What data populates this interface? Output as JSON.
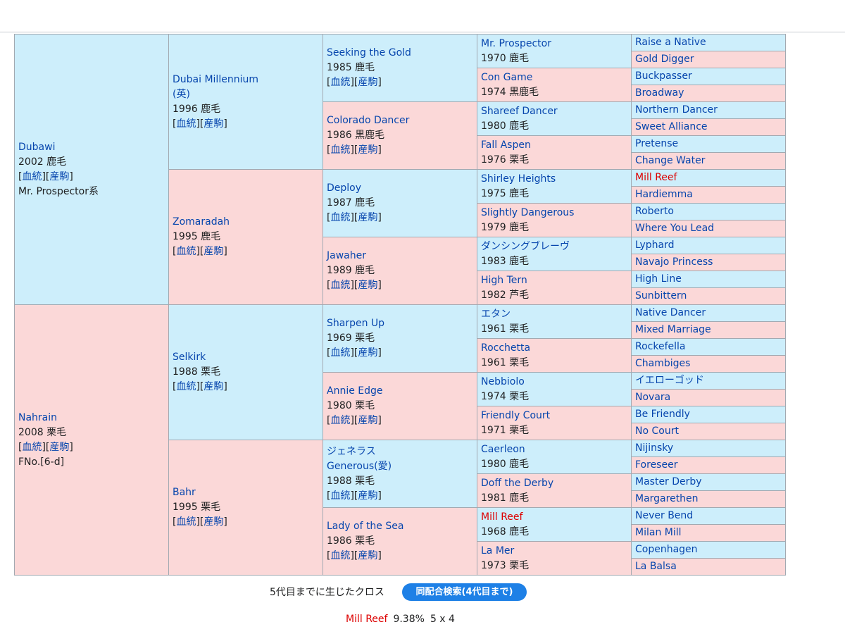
{
  "pedigree": {
    "sire": {
      "name": "Dubawi",
      "year_color": "2002 鹿毛",
      "blood": "血統",
      "progeny": "産駒",
      "note": "Mr. Prospector系"
    },
    "dam": {
      "name": "Nahrain",
      "year_color": "2008 栗毛",
      "blood": "血統",
      "progeny": "産駒",
      "note": "FNo.[6-d]"
    },
    "g2": [
      {
        "name": "Dubai Millennium",
        "name2": "(英)",
        "year_color": "1996 鹿毛",
        "blood": "血統",
        "progeny": "産駒"
      },
      {
        "name": "Zomaradah",
        "year_color": "1995 鹿毛",
        "blood": "血統",
        "progeny": "産駒"
      },
      {
        "name": "Selkirk",
        "year_color": "1988 栗毛",
        "blood": "血統",
        "progeny": "産駒"
      },
      {
        "name": "Bahr",
        "year_color": "1995 栗毛",
        "blood": "血統",
        "progeny": "産駒"
      }
    ],
    "g3": [
      {
        "name": "Seeking the Gold",
        "year_color": "1985 鹿毛",
        "blood": "血統",
        "progeny": "産駒"
      },
      {
        "name": "Colorado Dancer",
        "year_color": "1986 黒鹿毛",
        "blood": "血統",
        "progeny": "産駒"
      },
      {
        "name": "Deploy",
        "year_color": "1987 鹿毛",
        "blood": "血統",
        "progeny": "産駒"
      },
      {
        "name": "Jawaher",
        "year_color": "1989 鹿毛",
        "blood": "血統",
        "progeny": "産駒"
      },
      {
        "name": "Sharpen Up",
        "year_color": "1969 栗毛",
        "blood": "血統",
        "progeny": "産駒"
      },
      {
        "name": "Annie Edge",
        "year_color": "1980 栗毛",
        "blood": "血統",
        "progeny": "産駒"
      },
      {
        "name": "ジェネラス",
        "name2": "Generous(愛)",
        "year_color": "1988 栗毛",
        "blood": "血統",
        "progeny": "産駒"
      },
      {
        "name": "Lady of the Sea",
        "year_color": "1986 栗毛",
        "blood": "血統",
        "progeny": "産駒"
      }
    ],
    "g4": [
      {
        "name": "Mr. Prospector",
        "year_color": "1970 鹿毛"
      },
      {
        "name": "Con Game",
        "year_color": "1974 黒鹿毛"
      },
      {
        "name": "Shareef Dancer",
        "year_color": "1980 鹿毛"
      },
      {
        "name": "Fall Aspen",
        "year_color": "1976 栗毛"
      },
      {
        "name": "Shirley Heights",
        "year_color": "1975 鹿毛"
      },
      {
        "name": "Slightly Dangerous",
        "year_color": "1979 鹿毛"
      },
      {
        "name": "ダンシングブレーヴ",
        "year_color": "1983 鹿毛"
      },
      {
        "name": "High Tern",
        "year_color": "1982 芦毛"
      },
      {
        "name": "エタン",
        "year_color": "1961 栗毛"
      },
      {
        "name": "Rocchetta",
        "year_color": "1961 栗毛"
      },
      {
        "name": "Nebbiolo",
        "year_color": "1974 栗毛"
      },
      {
        "name": "Friendly Court",
        "year_color": "1971 栗毛"
      },
      {
        "name": "Caerleon",
        "year_color": "1980 鹿毛"
      },
      {
        "name": "Doff the Derby",
        "year_color": "1981 鹿毛"
      },
      {
        "name": "Mill Reef",
        "year_color": "1968 鹿毛",
        "duplicate": true
      },
      {
        "name": "La Mer",
        "year_color": "1973 栗毛"
      }
    ],
    "g5": [
      {
        "name": "Raise a Native"
      },
      {
        "name": "Gold Digger"
      },
      {
        "name": "Buckpasser"
      },
      {
        "name": "Broadway"
      },
      {
        "name": "Northern Dancer"
      },
      {
        "name": "Sweet Alliance"
      },
      {
        "name": "Pretense"
      },
      {
        "name": "Change Water"
      },
      {
        "name": "Mill Reef",
        "duplicate": true
      },
      {
        "name": "Hardiemma"
      },
      {
        "name": "Roberto"
      },
      {
        "name": "Where You Lead"
      },
      {
        "name": "Lyphard"
      },
      {
        "name": "Navajo Princess"
      },
      {
        "name": "High Line"
      },
      {
        "name": "Sunbittern"
      },
      {
        "name": "Native Dancer"
      },
      {
        "name": "Mixed Marriage"
      },
      {
        "name": "Rockefella"
      },
      {
        "name": "Chambiges"
      },
      {
        "name": "イエローゴッド"
      },
      {
        "name": "Novara"
      },
      {
        "name": "Be Friendly"
      },
      {
        "name": "No Court"
      },
      {
        "name": "Nijinsky"
      },
      {
        "name": "Foreseer"
      },
      {
        "name": "Master Derby"
      },
      {
        "name": "Margarethen"
      },
      {
        "name": "Never Bend"
      },
      {
        "name": "Milan Mill"
      },
      {
        "name": "Copenhagen"
      },
      {
        "name": "La Balsa"
      }
    ]
  },
  "footer": {
    "cross_label": "5代目までに生じたクロス",
    "search_button": "同配合検索(4代目まで)",
    "cross_name": "Mill Reef",
    "cross_percent": "9.38%",
    "cross_gen": "5 x 4"
  },
  "colors": {
    "male_bg": "#cdeefb",
    "female_bg": "#fbd8d8",
    "link": "#0645ad",
    "duplicate": "#dd0000",
    "button": "#1e80e6"
  }
}
